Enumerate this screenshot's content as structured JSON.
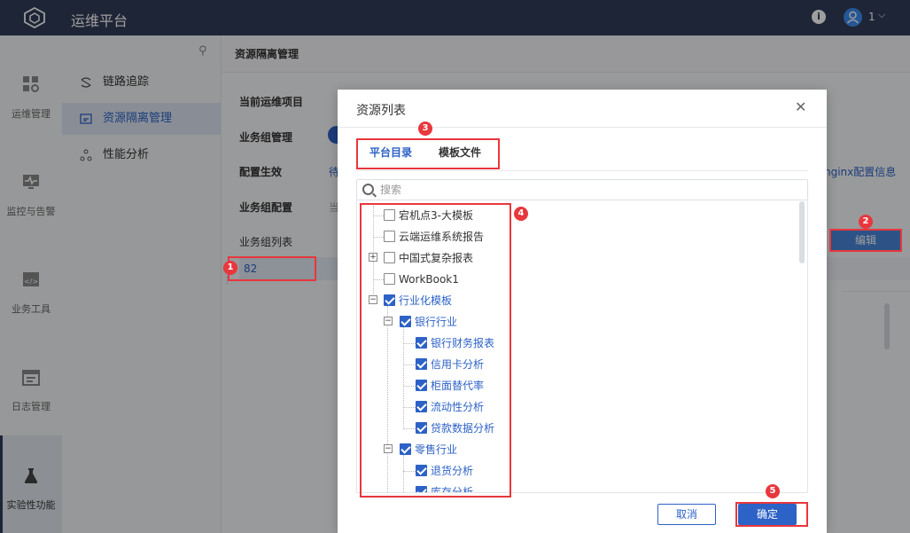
{
  "app": {
    "title": "运维平台",
    "user_label": "1"
  },
  "rail": [
    {
      "label": "运维管理",
      "icon": "grid-gear-icon"
    },
    {
      "label": "监控与告警",
      "icon": "monitor-pulse-icon"
    },
    {
      "label": "业务工具",
      "icon": "code-window-icon"
    },
    {
      "label": "日志管理",
      "icon": "calendar-log-icon"
    },
    {
      "label": "实验性功能",
      "icon": "flask-icon"
    }
  ],
  "submenu": [
    {
      "label": "链路追踪",
      "icon": "trace-icon"
    },
    {
      "label": "资源隔离管理",
      "icon": "resource-icon"
    },
    {
      "label": "性能分析",
      "icon": "perf-icon"
    }
  ],
  "main": {
    "page_title": "资源隔离管理",
    "fields": {
      "current_project": "当前运维项目",
      "group_management": "业务组管理",
      "config_effective": "配置生效",
      "config_pending": "待",
      "group_config": "业务组配置",
      "group_config_value": "当",
      "group_list": "业务组列表"
    },
    "nginx_link": "nginx配置信息",
    "group_items": [
      "82"
    ],
    "edit_button": "编辑"
  },
  "dialog": {
    "title": "资源列表",
    "tabs": [
      "平台目录",
      "模板文件"
    ],
    "search_placeholder": "搜索",
    "tree": [
      {
        "label": "宕机点3-大模板",
        "checked": false
      },
      {
        "label": "云端运维系统报告",
        "checked": false
      },
      {
        "label": "中国式复杂报表",
        "checked": false
      },
      {
        "label": "WorkBook1",
        "checked": false
      },
      {
        "label": "行业化模板",
        "checked": true
      },
      {
        "label": "银行行业",
        "checked": true
      },
      {
        "label": "银行财务报表",
        "checked": true
      },
      {
        "label": "信用卡分析",
        "checked": true
      },
      {
        "label": "柜面替代率",
        "checked": true
      },
      {
        "label": "流动性分析",
        "checked": true
      },
      {
        "label": "贷款数据分析",
        "checked": true
      },
      {
        "label": "零售行业",
        "checked": true
      },
      {
        "label": "退货分析",
        "checked": true
      },
      {
        "label": "库存分析",
        "checked": true
      }
    ],
    "cancel": "取消",
    "confirm": "确定"
  },
  "markers": [
    "1",
    "2",
    "3",
    "4",
    "5"
  ],
  "colors": {
    "topbar": "#2f3d57",
    "accent": "#2d62c6",
    "highlight": "#e8373d"
  }
}
